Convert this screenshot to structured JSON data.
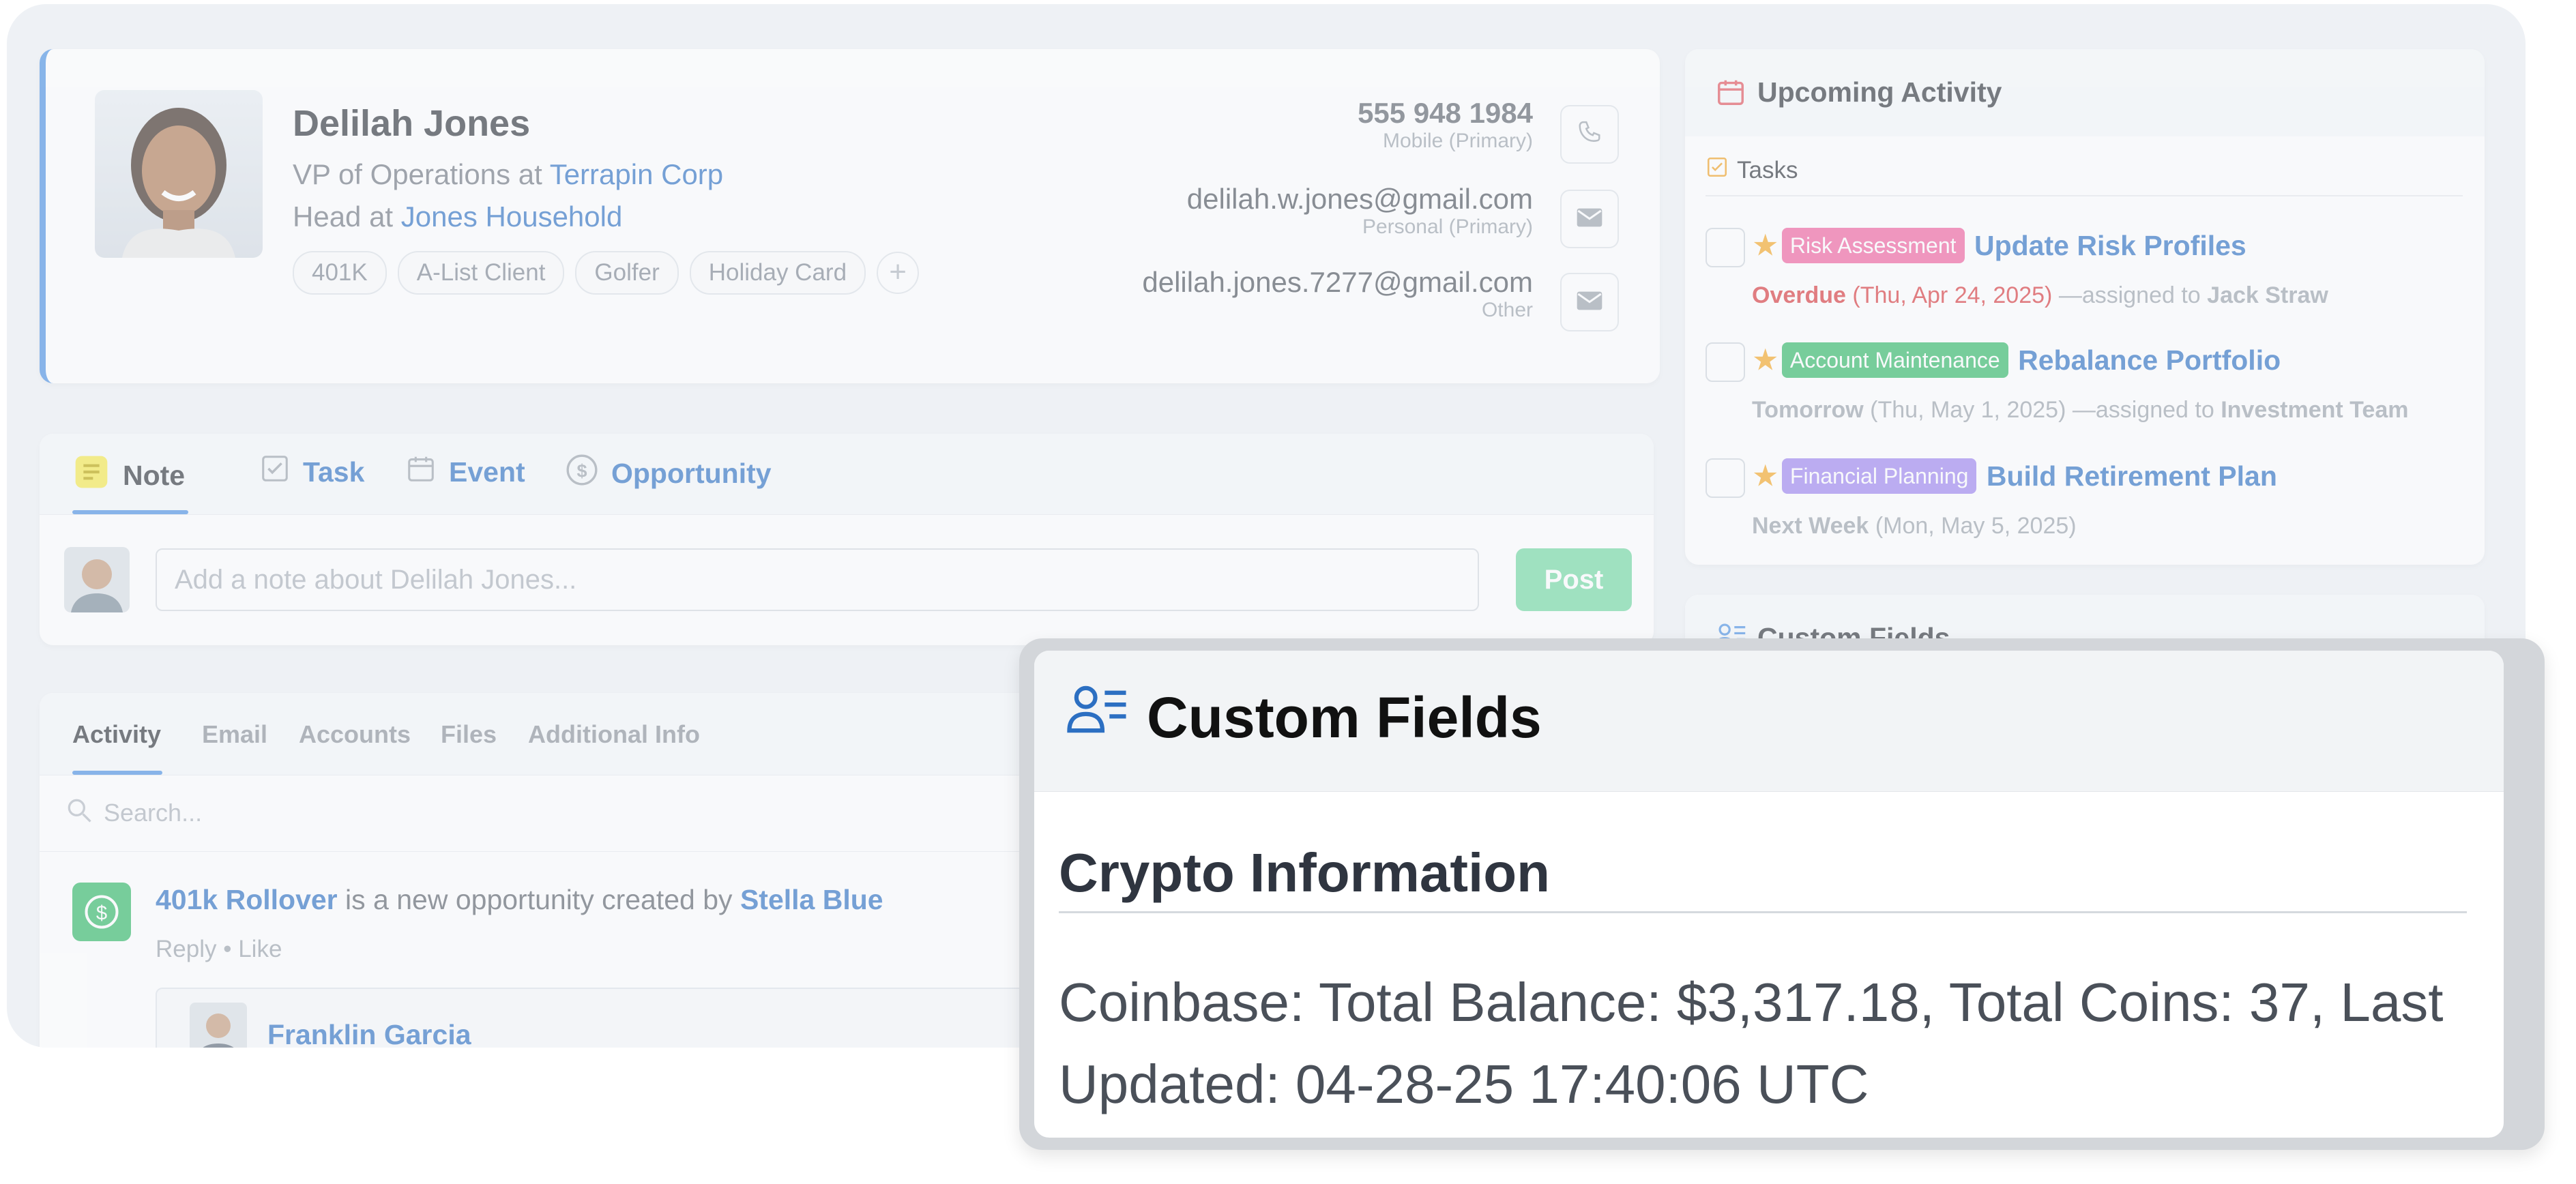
{
  "contact": {
    "name": "Delilah Jones",
    "role_prefix": "VP of Operations at",
    "company": "Terrapin Corp",
    "household_prefix": "Head at",
    "household": "Jones Household",
    "tags": [
      "401K",
      "A-List Client",
      "Golfer",
      "Holiday Card"
    ],
    "phone": "555 948 1984",
    "phone_label": "Mobile (Primary)",
    "email_primary": "delilah.w.jones@gmail.com",
    "email_primary_label": "Personal (Primary)",
    "email_other": "delilah.jones.7277@gmail.com",
    "email_other_label": "Other"
  },
  "composer": {
    "tabs": [
      "Note",
      "Task",
      "Event",
      "Opportunity"
    ],
    "placeholder": "Add a note about Delilah Jones...",
    "post_label": "Post"
  },
  "activity": {
    "tabs": [
      "Activity",
      "Email",
      "Accounts",
      "Files",
      "Additional Info"
    ],
    "search_placeholder": "Search...",
    "item_link": "401k Rollover",
    "item_text": "is a new opportunity created by",
    "item_author": "Stella Blue",
    "reply_label": "Reply",
    "separator": "•",
    "like_label": "Like",
    "reply_author": "Franklin Garcia"
  },
  "upcoming": {
    "title": "Upcoming Activity",
    "tasks_label": "Tasks",
    "tasks": [
      {
        "badge": "Risk Assessment",
        "badge_color": "#f0609e",
        "title": "Update Risk Profiles",
        "when": "Overdue",
        "date": "(Thu, Apr 24, 2025)",
        "assign_prefix": "—assigned to",
        "assignee": "Jack Straw"
      },
      {
        "badge": "Account Maintenance",
        "badge_color": "#2fb865",
        "title": "Rebalance Portfolio",
        "when": "Tomorrow",
        "date": "(Thu, May 1, 2025)",
        "assign_prefix": "—assigned to",
        "assignee": "Investment Team"
      },
      {
        "badge": "Financial Planning",
        "badge_color": "#9c82f0",
        "title": "Build Retirement Plan",
        "when": "Next Week",
        "date": "(Mon, May 5, 2025)"
      }
    ]
  },
  "custom_fields_peek": "Custom Fields",
  "zoom": {
    "title": "Custom Fields",
    "section": "Crypto Information",
    "text": "Coinbase: Total Balance: $3,317.18, Total Coins: 37, Last Updated: 04-28-25 17:40:06 UTC"
  },
  "colors": {
    "accent": "#2c6fc2",
    "overdue": "#d9373b",
    "post_button": "#6fd8a0"
  }
}
